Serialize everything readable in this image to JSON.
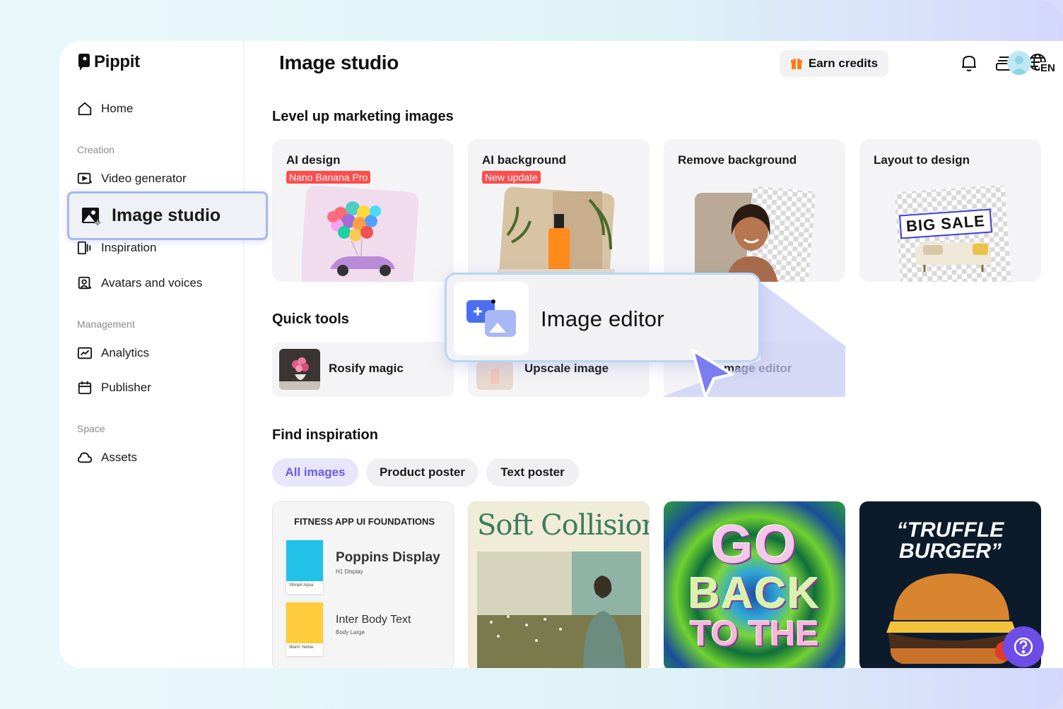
{
  "app": {
    "brand": "Pippit"
  },
  "sidebar": {
    "home": "Home",
    "section_creation": "Creation",
    "video_generator": "Video generator",
    "image_studio": "Image studio",
    "inspiration": "Inspiration",
    "avatars": "Avatars and voices",
    "section_management": "Management",
    "analytics": "Analytics",
    "publisher": "Publisher",
    "section_space": "Space",
    "assets": "Assets"
  },
  "header": {
    "title": "Image studio",
    "earn_credits": "Earn credits",
    "lang": "EN"
  },
  "marketing": {
    "heading": "Level up marketing images",
    "cards": [
      {
        "title": "AI design",
        "tag": "Nano Banana Pro"
      },
      {
        "title": "AI background",
        "tag": "New update"
      },
      {
        "title": "Remove background"
      },
      {
        "title": "Layout to design",
        "sign": "BIG SALE"
      }
    ]
  },
  "quick_tools": {
    "heading": "Quick tools",
    "items": [
      "Rosify magic",
      "Upscale image",
      "mage editor"
    ]
  },
  "popup": {
    "label": "Image editor"
  },
  "inspiration": {
    "heading": "Find inspiration",
    "chips": [
      "All images",
      "Product poster",
      "Text poster"
    ],
    "cards": {
      "fitness": {
        "title": "FITNESS APP UI FOUNDATIONS",
        "font1": "Poppins Display",
        "font1_sub": "H1 Display",
        "swatch1": "Vibrant Aqua",
        "font2": "Inter Body Text",
        "font2_sub": "Body Large",
        "swatch2": "Warm Yellow"
      },
      "soft": {
        "title": "Soft Collision"
      },
      "go": {
        "line1": "GO",
        "line2": "BACK",
        "line3": "TO THE"
      },
      "truffle": {
        "line1": "“TRUFFLE",
        "line2": "BURGER”"
      }
    }
  },
  "colors": {
    "accent": "#6c4ee6",
    "tag_red": "#ff4c4c",
    "highlight_border": "#a9b7f0"
  }
}
